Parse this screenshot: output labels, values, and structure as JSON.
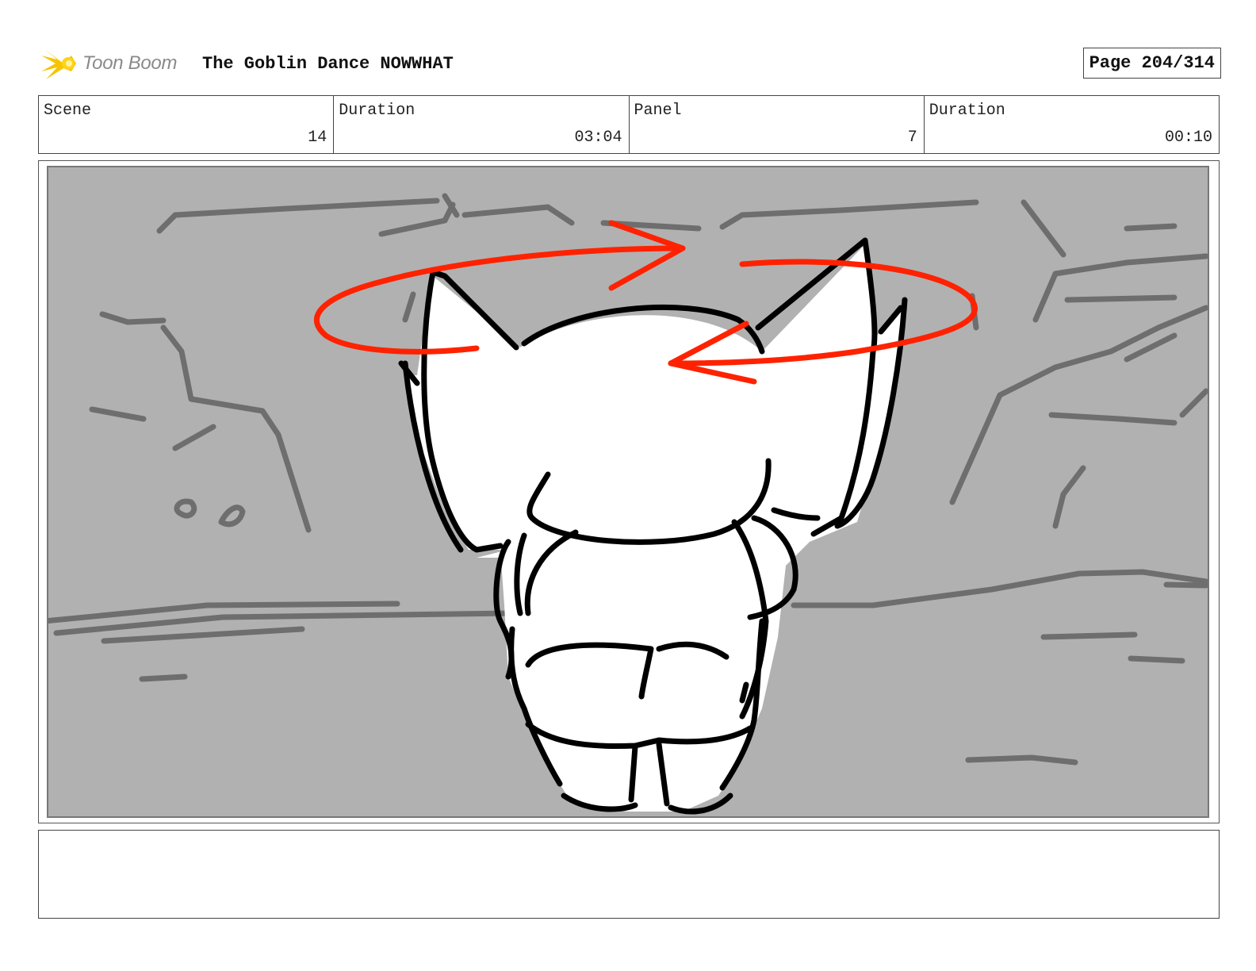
{
  "header": {
    "logo_text": "Toon Boom",
    "title": "The Goblin Dance NOWWHAT",
    "page_label": "Page 204/314"
  },
  "info": {
    "scene_label": "Scene",
    "scene_value": "14",
    "scene_duration_label": "Duration",
    "scene_duration_value": "03:04",
    "panel_label": "Panel",
    "panel_value": "7",
    "panel_duration_label": "Duration",
    "panel_duration_value": "00:10"
  },
  "colors": {
    "background_fill": "#b1b1b1",
    "sketch_lines": "#6e6e6e",
    "character_lines": "#000000",
    "motion_arrows": "#ff2200",
    "logo_yellow": "#f7c400"
  },
  "notes": {
    "text": ""
  }
}
